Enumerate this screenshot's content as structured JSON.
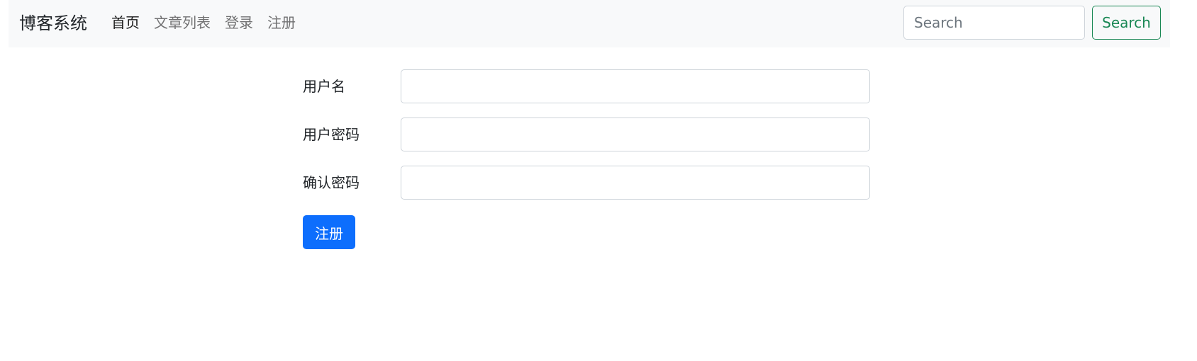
{
  "navbar": {
    "brand": "博客系统",
    "links": [
      {
        "label": "首页",
        "active": true
      },
      {
        "label": "文章列表",
        "active": false
      },
      {
        "label": "登录",
        "active": false
      },
      {
        "label": "注册",
        "active": false
      }
    ],
    "search": {
      "placeholder": "Search",
      "value": "",
      "button_label": "Search"
    }
  },
  "form": {
    "fields": [
      {
        "label": "用户名",
        "value": ""
      },
      {
        "label": "用户密码",
        "value": ""
      },
      {
        "label": "确认密码",
        "value": ""
      }
    ],
    "submit_label": "注册"
  },
  "colors": {
    "navbar_bg": "#f8f9fa",
    "primary": "#0d6efd",
    "success": "#198754",
    "border": "#ced4da"
  }
}
